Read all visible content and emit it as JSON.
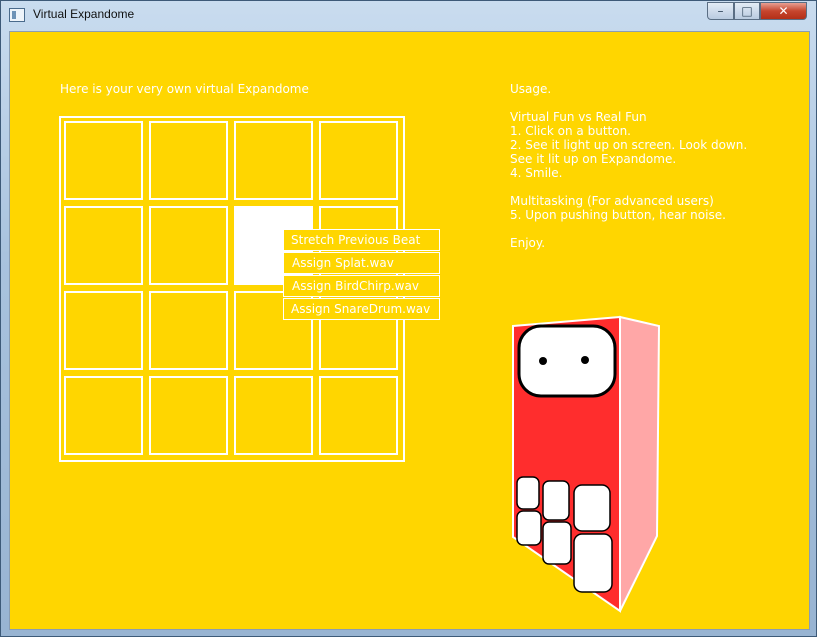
{
  "window": {
    "title": "Virtual Expandome"
  },
  "controls": {
    "minimize": "–",
    "maximize": "□",
    "close": "✕"
  },
  "main": {
    "heading": "Here is your very own virtual Expandome"
  },
  "grid": {
    "rows": 4,
    "cols": 4,
    "lit_cell": [
      1,
      2
    ]
  },
  "instructions": {
    "lines": [
      "Usage.",
      "",
      "Virtual Fun vs Real Fun",
      "1. Click on a button.",
      "2. See it light up on screen. Look down.",
      "See it lit up on Expandome.",
      "4. Smile.",
      "",
      "Multitasking (For advanced users)",
      "5. Upon pushing button, hear noise.",
      "",
      "Enjoy."
    ]
  },
  "context_menu": {
    "items": [
      "Stretch Previous Beat",
      "Assign Splat.wav",
      "Assign BirdChirp.wav",
      "Assign SnareDrum.wav"
    ]
  },
  "colors": {
    "background": "#ffd600",
    "line": "#ffffff",
    "mascot_front": "#ff2d2d",
    "mascot_side": "#ffa7a7"
  }
}
